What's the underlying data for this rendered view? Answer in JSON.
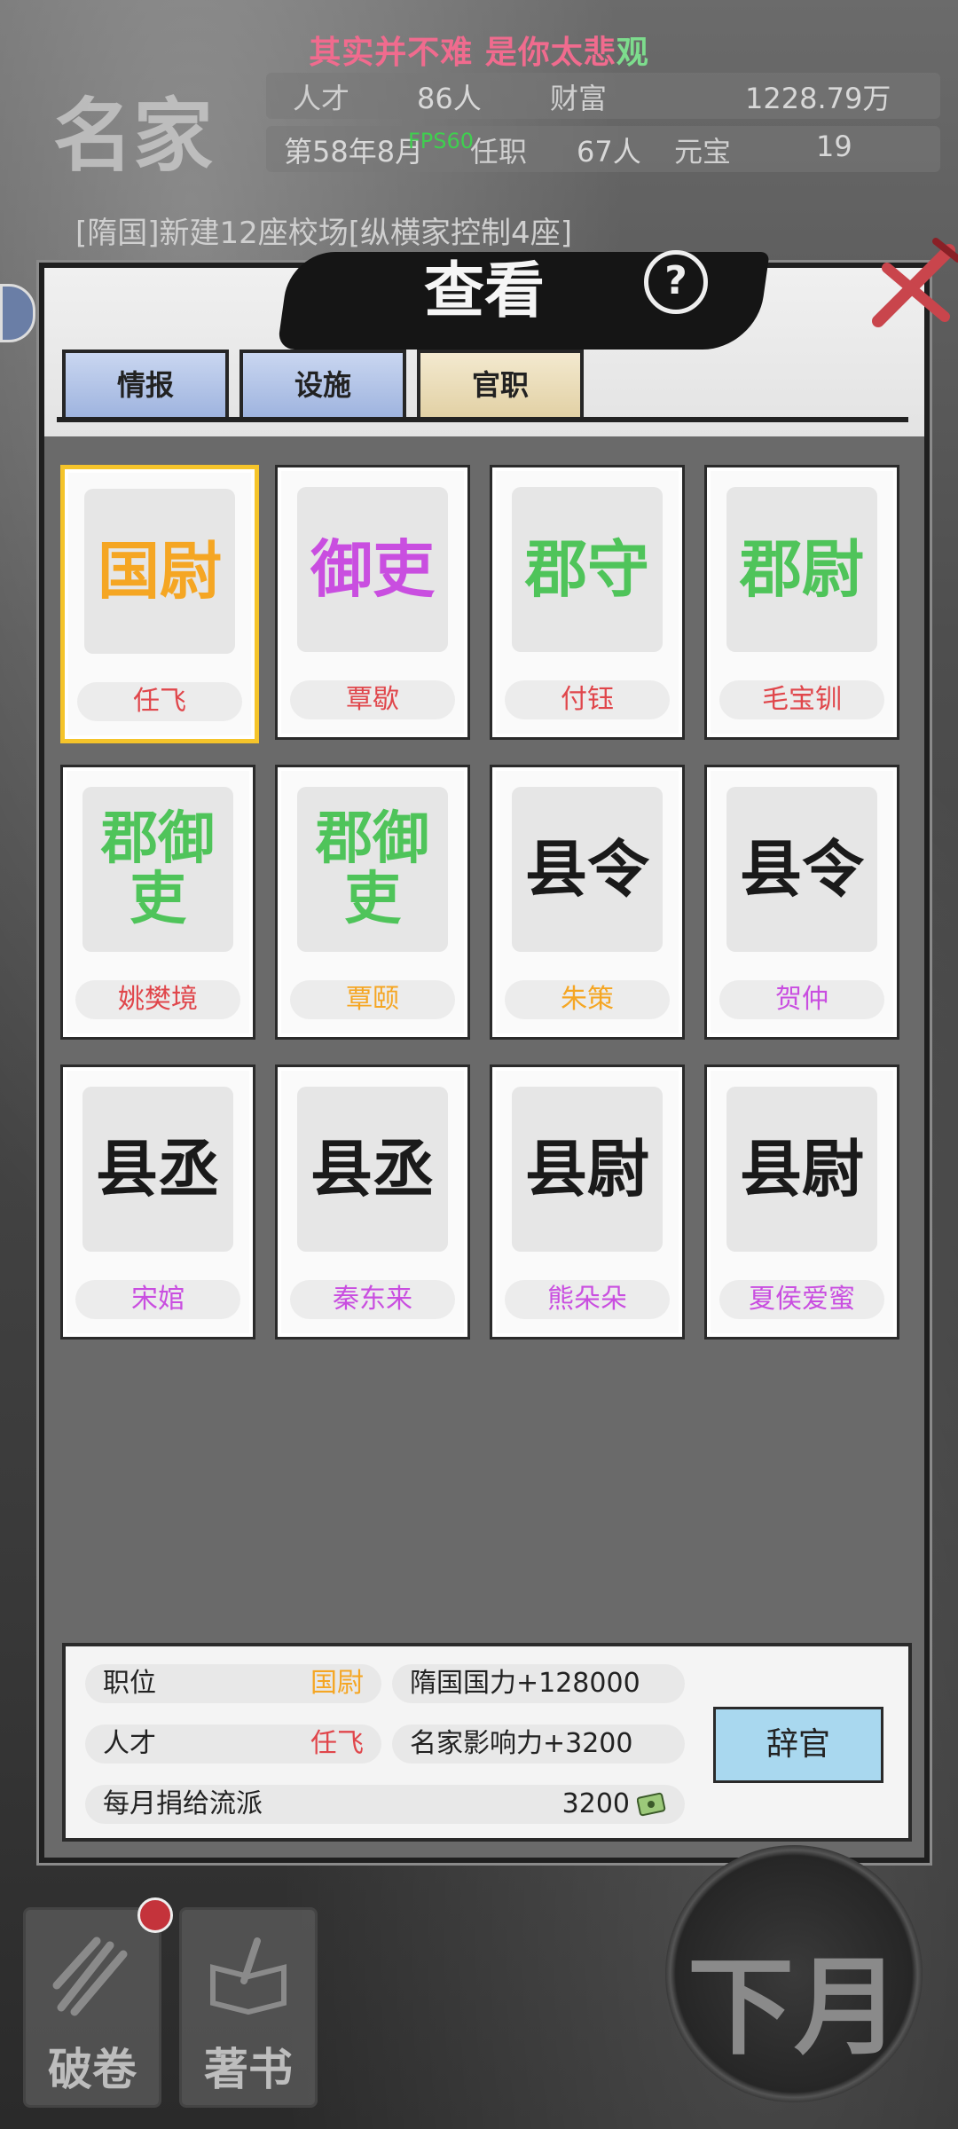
{
  "banner": {
    "main": "其实并不难 是你太悲",
    "tail": "观"
  },
  "fps": "FPS60",
  "header": {
    "logo": "名家",
    "talent_label": "人才",
    "talent_value": "86人",
    "wealth_label": "财富",
    "wealth_value": "1228.79万",
    "date": "第58年8月",
    "office_label": "任职",
    "office_value": "67人",
    "ingot_label": "元宝",
    "ingot_value": "19"
  },
  "ticker": "[隋国]新建12座校场[纵横家控制4座]",
  "panel": {
    "title": "查看",
    "help": "?",
    "tabs": [
      {
        "label": "情报",
        "active": false
      },
      {
        "label": "设施",
        "active": false
      },
      {
        "label": "官职",
        "active": true
      }
    ]
  },
  "officials": [
    {
      "title": "国尉",
      "name": "任飞",
      "title_color": "#f5a623",
      "name_color": "#e0464b",
      "selected": true
    },
    {
      "title": "御吏",
      "name": "覃歇",
      "title_color": "#c94ee0",
      "name_color": "#e0464b",
      "selected": false
    },
    {
      "title": "郡守",
      "name": "付钰",
      "title_color": "#4fc45a",
      "name_color": "#e0464b",
      "selected": false
    },
    {
      "title": "郡尉",
      "name": "毛宝钏",
      "title_color": "#4fc45a",
      "name_color": "#e0464b",
      "selected": false
    },
    {
      "title": "郡御吏",
      "name": "姚樊境",
      "title_color": "#4fc45a",
      "name_color": "#e0464b",
      "selected": false
    },
    {
      "title": "郡御吏",
      "name": "覃颐",
      "title_color": "#4fc45a",
      "name_color": "#f5a623",
      "selected": false
    },
    {
      "title": "县令",
      "name": "朱策",
      "title_color": "#1a1a1a",
      "name_color": "#f5a623",
      "selected": false
    },
    {
      "title": "县令",
      "name": "贺仲",
      "title_color": "#1a1a1a",
      "name_color": "#c94ee0",
      "selected": false
    },
    {
      "title": "县丞",
      "name": "宋婠",
      "title_color": "#1a1a1a",
      "name_color": "#c94ee0",
      "selected": false
    },
    {
      "title": "县丞",
      "name": "秦东来",
      "title_color": "#1a1a1a",
      "name_color": "#c94ee0",
      "selected": false
    },
    {
      "title": "县尉",
      "name": "熊朵朵",
      "title_color": "#1a1a1a",
      "name_color": "#c94ee0",
      "selected": false
    },
    {
      "title": "县尉",
      "name": "夏侯爱蜜",
      "title_color": "#1a1a1a",
      "name_color": "#c94ee0",
      "selected": false
    }
  ],
  "info": {
    "position_label": "职位",
    "position_value": "国尉",
    "talent_label": "人才",
    "talent_value": "任飞",
    "monthly_label": "每月捐给流派",
    "monthly_value": "3200",
    "bonus1": "隋国国力+128000",
    "bonus2": "名家影响力+3200",
    "resign": "辞官"
  },
  "bottom": {
    "pojuan": "破卷",
    "zhushu": "著书",
    "next_month": "下月"
  },
  "colors": {
    "accent_gold": "#f5c42a",
    "resign_blue": "#a9d8ef"
  }
}
